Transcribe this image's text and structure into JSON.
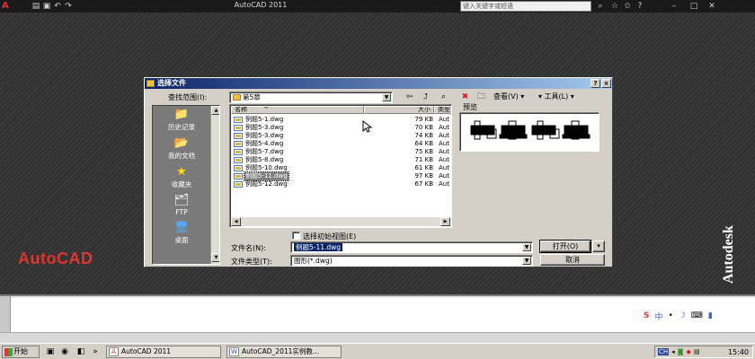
{
  "app": {
    "title": "AutoCAD 2011",
    "menu_button": "A",
    "search_placeholder": "键入关键字或短语",
    "autocad_logo": "AutoCAD",
    "autodesk_logo": "Autodesk"
  },
  "dialog": {
    "title": "选择文件",
    "help_button": "?",
    "close_button": "×",
    "look_in_label": "查找范围(I):",
    "look_in_value": "第5章",
    "view_menu": "查看(V)",
    "tools_menu": "工具(L)",
    "places": [
      {
        "label": "历史记录",
        "icon": "history-folder-icon",
        "glyph": "📁"
      },
      {
        "label": "我的文档",
        "icon": "my-documents-icon",
        "glyph": "📂"
      },
      {
        "label": "收藏夹",
        "icon": "favorites-star-icon",
        "glyph": "★"
      },
      {
        "label": "FTP",
        "icon": "ftp-icon",
        "glyph": "🗂"
      },
      {
        "label": "桌面",
        "icon": "desktop-icon",
        "glyph": "🖥"
      }
    ],
    "columns": {
      "name": "名称",
      "sort_indicator": "^",
      "size": "大小",
      "type": "类型"
    },
    "files": [
      {
        "name": "例题5-1.dwg",
        "size": "79 KB",
        "type": "Aut"
      },
      {
        "name": "例题5-3.dwg",
        "size": "70 KB",
        "type": "Aut"
      },
      {
        "name": "例题5-3.dwg",
        "size": "74 KB",
        "type": "Aut"
      },
      {
        "name": "例题5-4.dwg",
        "size": "64 KB",
        "type": "Aut"
      },
      {
        "name": "例题5-7.dwg",
        "size": "75 KB",
        "type": "Aut"
      },
      {
        "name": "例题5-8.dwg",
        "size": "71 KB",
        "type": "Aut"
      },
      {
        "name": "例题5-10.dwg",
        "size": "61 KB",
        "type": "Aut"
      },
      {
        "name": "例题5-11.dwg",
        "size": "97 KB",
        "type": "Aut",
        "selected": true
      },
      {
        "name": "例题5-12.dwg",
        "size": "67 KB",
        "type": "Aut"
      }
    ],
    "preview_label": "预览",
    "initial_view_checkbox": "选择初始视图(E)",
    "filename_label": "文件名(N):",
    "filename_value": "例题5-11.dwg",
    "filetype_label": "文件类型(T):",
    "filetype_value": "图形(*.dwg)",
    "open_button": "打开(O)",
    "open_dropdown": "▾",
    "cancel_button": "取消"
  },
  "taskbar": {
    "start": "开始",
    "tasks": [
      {
        "label": "AutoCAD 2011",
        "icon_glyph": "A"
      },
      {
        "label": "AutoCAD_2011实例教...",
        "icon_glyph": "W"
      }
    ],
    "tray_lang": "CH",
    "clock": "15:40"
  },
  "ime": {
    "icons": [
      "S",
      "中",
      "•",
      "☽",
      "⌨",
      "▮"
    ]
  }
}
